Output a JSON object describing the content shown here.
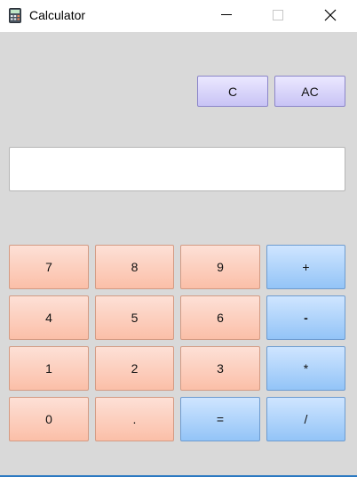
{
  "window": {
    "title": "Calculator",
    "controls": [
      "minimize",
      "maximize",
      "close"
    ]
  },
  "display": {
    "value": ""
  },
  "clear_buttons": [
    {
      "label": "C"
    },
    {
      "label": "AC"
    }
  ],
  "keypad": {
    "rows": [
      [
        {
          "label": "7",
          "kind": "num"
        },
        {
          "label": "8",
          "kind": "num"
        },
        {
          "label": "9",
          "kind": "num"
        },
        {
          "label": "+",
          "kind": "op"
        }
      ],
      [
        {
          "label": "4",
          "kind": "num"
        },
        {
          "label": "5",
          "kind": "num"
        },
        {
          "label": "6",
          "kind": "num"
        },
        {
          "label": "-",
          "kind": "op"
        }
      ],
      [
        {
          "label": "1",
          "kind": "num"
        },
        {
          "label": "2",
          "kind": "num"
        },
        {
          "label": "3",
          "kind": "num"
        },
        {
          "label": "*",
          "kind": "op"
        }
      ],
      [
        {
          "label": "0",
          "kind": "num"
        },
        {
          "label": ".",
          "kind": "num"
        },
        {
          "label": "=",
          "kind": "op"
        },
        {
          "label": "/",
          "kind": "op"
        }
      ]
    ]
  },
  "colors": {
    "digit_button": "#fbc9b6",
    "operator_button": "#a9d0fb",
    "clear_button": "#d6d2fb",
    "background": "#d9d9d9"
  }
}
